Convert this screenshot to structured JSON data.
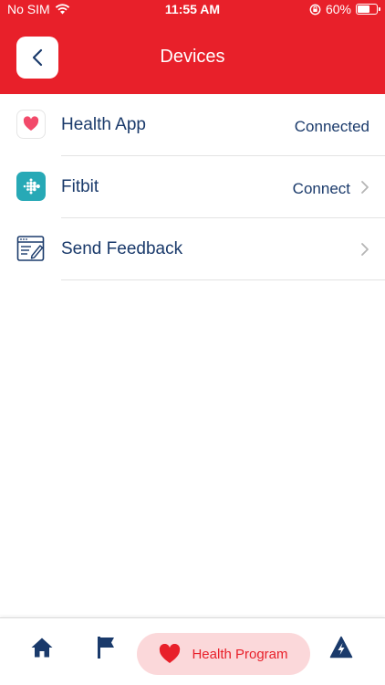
{
  "status_bar": {
    "carrier": "No SIM",
    "time": "11:55 AM",
    "battery": "60%",
    "battery_level": 0.6
  },
  "header": {
    "title": "Devices",
    "back_icon": "chevron-left-icon"
  },
  "devices": [
    {
      "label": "Health App",
      "status": "Connected",
      "icon": "heart-app-icon",
      "has_chevron": false
    },
    {
      "label": "Fitbit",
      "status": "Connect",
      "icon": "fitbit-icon",
      "has_chevron": true
    },
    {
      "label": "Send Feedback",
      "status": "",
      "icon": "feedback-icon",
      "has_chevron": true
    }
  ],
  "tab_bar": {
    "items": [
      {
        "name": "home",
        "icon": "home-icon",
        "label": ""
      },
      {
        "name": "goals",
        "icon": "flag-icon",
        "label": ""
      },
      {
        "name": "health-program",
        "icon": "heart-icon",
        "label": "Health Program",
        "active": true
      },
      {
        "name": "activity",
        "icon": "bolt-icon",
        "label": ""
      }
    ]
  },
  "colors": {
    "brand_red": "#e8202a",
    "text_navy": "#1a3a6b",
    "active_tab_bg": "#fbd8da",
    "fitbit_teal": "#27a9b6"
  }
}
